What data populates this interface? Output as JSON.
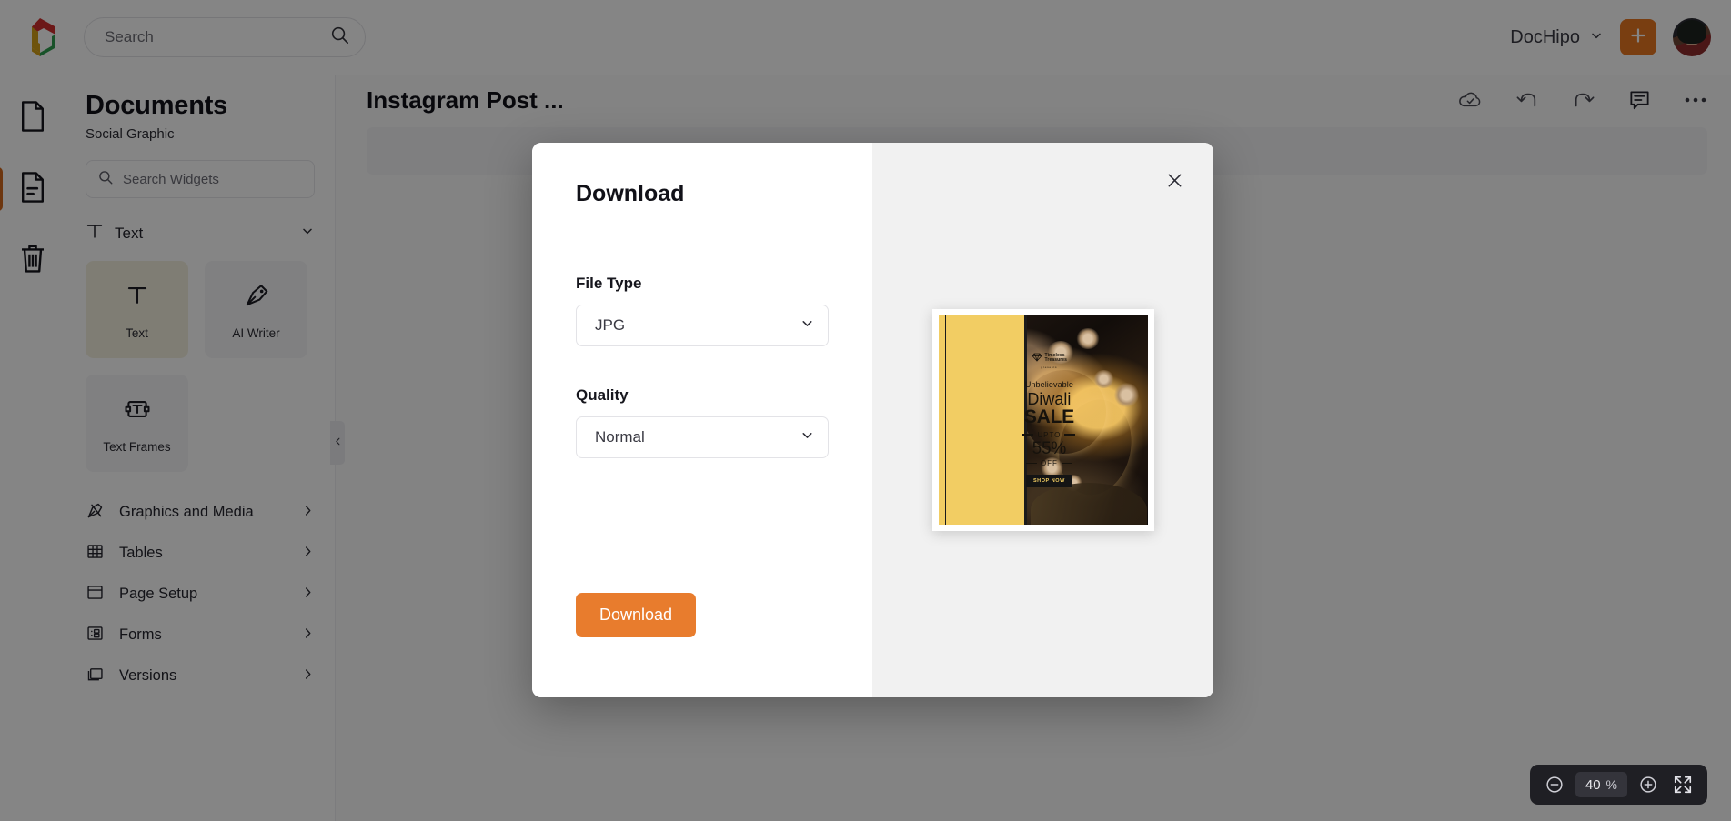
{
  "header": {
    "search_placeholder": "Search",
    "search_value": "",
    "search_icon": "search-icon",
    "logo_icon": "dochipo-logo-icon",
    "workspace_label": "DocHipo",
    "workspace_chevron_icon": "chevron-down-icon",
    "add_button_icon": "plus-icon",
    "avatar_icon": "user-avatar"
  },
  "rail": {
    "items": [
      {
        "name": "document-icon",
        "label": "Document",
        "active": false
      },
      {
        "name": "pages-icon",
        "label": "Pages",
        "active": true
      },
      {
        "name": "trash-icon",
        "label": "Trash",
        "active": false
      }
    ]
  },
  "panel": {
    "title": "Documents",
    "subtitle": "Social Graphic",
    "search_placeholder": "Search Widgets",
    "search_value": "",
    "search_icon": "search-icon",
    "section": {
      "label": "Text",
      "icon": "text-t-icon",
      "chevron": "chevron-down-icon"
    },
    "tiles": [
      {
        "label": "Text",
        "icon": "text-t-icon",
        "selected": true
      },
      {
        "label": "AI Writer",
        "icon": "pen-nib-icon",
        "selected": false
      },
      {
        "label": "Text Frames",
        "icon": "text-frame-icon",
        "selected": false
      }
    ],
    "menu": [
      {
        "label": "Graphics and Media",
        "icon": "graphics-media-icon",
        "chevron": "chevron-right-icon"
      },
      {
        "label": "Tables",
        "icon": "table-grid-icon",
        "chevron": "chevron-right-icon"
      },
      {
        "label": "Page Setup",
        "icon": "page-setup-icon",
        "chevron": "chevron-right-icon"
      },
      {
        "label": "Forms",
        "icon": "forms-icon",
        "chevron": "chevron-right-icon"
      },
      {
        "label": "Versions",
        "icon": "versions-icon",
        "chevron": "chevron-right-icon"
      }
    ],
    "collapse_icon": "chevron-left-icon"
  },
  "editor": {
    "doc_title": "Instagram Post ...",
    "tools": [
      {
        "name": "cloud-saved-icon",
        "label": "Saved"
      },
      {
        "name": "undo-icon",
        "label": "Undo"
      },
      {
        "name": "redo-icon",
        "label": "Redo"
      },
      {
        "name": "comment-icon",
        "label": "Comments"
      },
      {
        "name": "more-options-icon",
        "label": "More"
      }
    ]
  },
  "zoom_control": {
    "minus_icon": "zoom-out-icon",
    "plus_icon": "zoom-in-icon",
    "fullscreen_icon": "fit-screen-icon",
    "value": "40",
    "unit": "%"
  },
  "modal": {
    "title": "Download",
    "close_icon": "close-icon",
    "file_type": {
      "label": "File Type",
      "value": "JPG",
      "chevron": "chevron-down-icon"
    },
    "quality": {
      "label": "Quality",
      "value": "Normal",
      "chevron": "chevron-down-icon"
    },
    "download_button": "Download"
  },
  "creative": {
    "brand_line1": "Timeless",
    "brand_line2": "Treasures",
    "brand_icon": "diamond-icon",
    "presents": "presents",
    "headline_small": "Unbelievable",
    "headline_1": "Diwali",
    "headline_2": "SALE",
    "upto": "UPTO",
    "percent": "55%",
    "off": "OFF",
    "cta": "SHOP NOW"
  },
  "colors": {
    "accent_orange": "#e87c2d",
    "brand_orange": "#e87722",
    "creative_yellow": "#f2cd63",
    "creative_dark": "#141414",
    "panel_border": "#ededf1",
    "zoombar_dark": "#1f1f24"
  }
}
